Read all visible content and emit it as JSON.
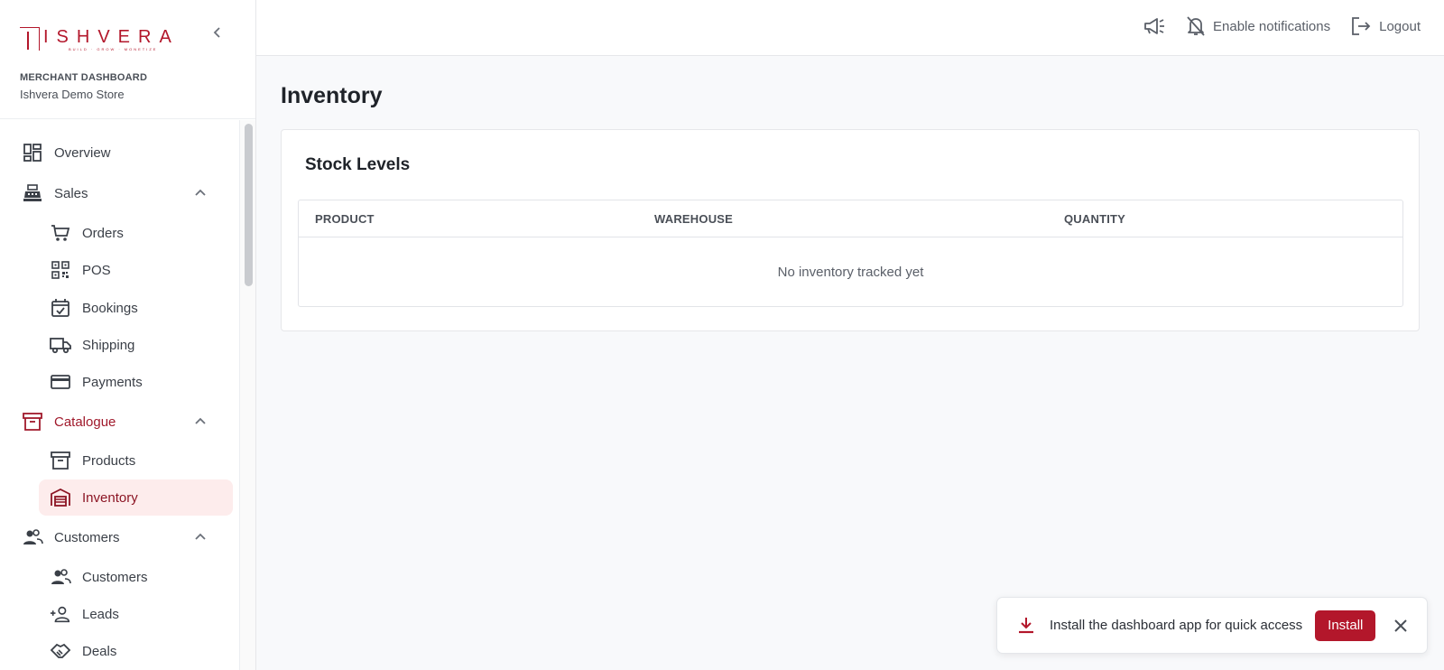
{
  "brand": {
    "logo_text": "ISHVERA",
    "logo_tagline": "BUILD · GROW · MONETIZE",
    "label": "MERCHANT DASHBOARD",
    "store": "Ishvera Demo Store",
    "accent_color": "#b3172b"
  },
  "sidebar": {
    "items": [
      {
        "label": "Overview",
        "icon": "dashboard-icon"
      },
      {
        "label": "Sales",
        "icon": "cash-register-icon",
        "expanded": true
      },
      {
        "label": "Orders",
        "icon": "cart-icon"
      },
      {
        "label": "POS",
        "icon": "qr-code-icon"
      },
      {
        "label": "Bookings",
        "icon": "calendar-check-icon"
      },
      {
        "label": "Shipping",
        "icon": "truck-icon"
      },
      {
        "label": "Payments",
        "icon": "credit-card-icon"
      },
      {
        "label": "Catalogue",
        "icon": "archive-box-icon",
        "expanded": true
      },
      {
        "label": "Products",
        "icon": "archive-box-icon"
      },
      {
        "label": "Inventory",
        "icon": "warehouse-icon",
        "active": true
      },
      {
        "label": "Customers",
        "icon": "people-icon",
        "expanded": true
      },
      {
        "label": "Customers",
        "icon": "people-icon"
      },
      {
        "label": "Leads",
        "icon": "add-person-icon"
      },
      {
        "label": "Deals",
        "icon": "handshake-icon"
      }
    ]
  },
  "topbar": {
    "announcements_icon": "megaphone-icon",
    "notifications_label": "Enable notifications",
    "logout_label": "Logout"
  },
  "main": {
    "title": "Inventory",
    "card_title": "Stock Levels",
    "columns": [
      "PRODUCT",
      "WAREHOUSE",
      "QUANTITY"
    ],
    "empty_text": "No inventory tracked yet"
  },
  "install_banner": {
    "text": "Install the dashboard app for quick access",
    "button_label": "Install"
  }
}
